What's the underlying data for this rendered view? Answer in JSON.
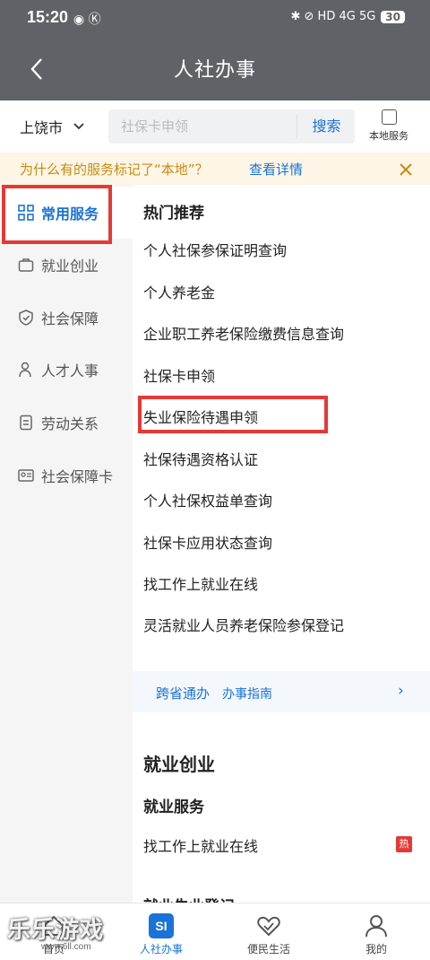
{
  "status": {
    "time": "15:20",
    "battery": "30",
    "left_icons": "◉ Ⓚ",
    "right_icons": "✱ ⊘ HD 4G 5G"
  },
  "header": {
    "title": "人社办事"
  },
  "search": {
    "city": "上饶市",
    "placeholder": "社保卡申领",
    "button": "搜索",
    "local_label": "本地服务"
  },
  "notice": {
    "question": "为什么有的服务标记了“本地”？",
    "link": "查看详情"
  },
  "sidebar": {
    "items": [
      {
        "label": "常用服务",
        "icon": "grid-icon",
        "active": true
      },
      {
        "label": "就业创业",
        "icon": "briefcase-icon"
      },
      {
        "label": "社会保障",
        "icon": "shield-icon"
      },
      {
        "label": "人才人事",
        "icon": "person-icon"
      },
      {
        "label": "劳动关系",
        "icon": "document-icon"
      },
      {
        "label": "社会保障卡",
        "icon": "id-card-icon"
      }
    ]
  },
  "main": {
    "hot_title": "热门推荐",
    "services": [
      "个人社保参保证明查询",
      "个人养老金",
      "企业职工养老保险缴费信息查询",
      "社保卡申领",
      "失业保险待遇申领",
      "社保待遇资格认证",
      "个人社保权益单查询",
      "社保卡应用状态查询",
      "找工作上就业在线",
      "灵活就业人员养老保险参保登记"
    ],
    "cross_province": {
      "label": "跨省通办",
      "guide": "办事指南",
      "arrow": "›"
    },
    "section2_title": "就业创业",
    "subsection_title": "就业服务",
    "sub_services": [
      "找工作上就业在线"
    ],
    "hot_badge": "热",
    "next_subsection": "就业失业登记"
  },
  "bottom_nav": {
    "tabs": [
      {
        "label": "首页",
        "icon": "home-icon"
      },
      {
        "label": "人社办事",
        "icon": "si-icon",
        "active": true,
        "icon_text": "SI"
      },
      {
        "label": "便民生活",
        "icon": "heart-hands-icon"
      },
      {
        "label": "我的",
        "icon": "user-icon"
      }
    ]
  },
  "watermark": {
    "text": "乐乐游戏",
    "url": "www.6ll.com"
  }
}
